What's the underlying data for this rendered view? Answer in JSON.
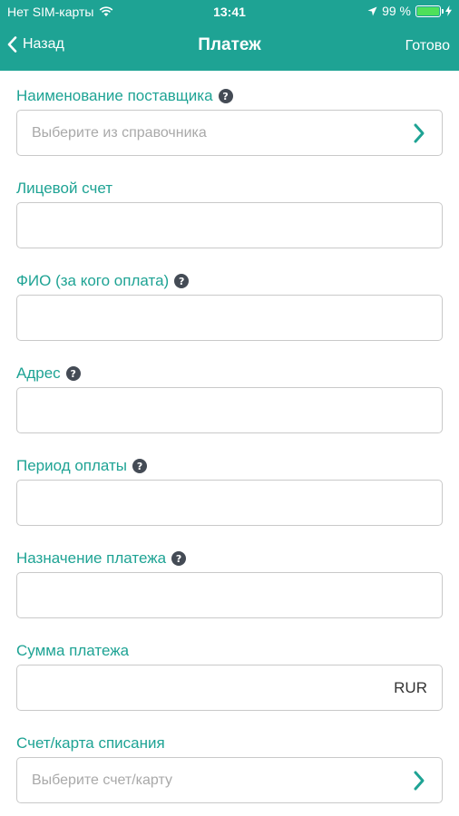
{
  "status": {
    "carrier": "Нет SIM-карты",
    "time": "13:41",
    "battery": "99 %",
    "battery_level": 0.99
  },
  "nav": {
    "back_label": "Назад",
    "title": "Платеж",
    "done_label": "Готово"
  },
  "fields": [
    {
      "label": "Наименование поставщика",
      "help": "?",
      "placeholder": "Выберите из справочника"
    },
    {
      "label": "Лицевой счет"
    },
    {
      "label": "ФИО (за кого оплата)",
      "help": "?"
    },
    {
      "label": "Адрес",
      "help": "?"
    },
    {
      "label": "Период оплаты",
      "help": "?"
    },
    {
      "label": "Назначение платежа",
      "help": "?"
    },
    {
      "label": "Сумма платежа",
      "suffix": "RUR"
    },
    {
      "label": "Счет/карта списания",
      "placeholder": "Выберите счет/карту"
    }
  ],
  "colors": {
    "accent": "#1ea394",
    "border": "#c9c9c9",
    "help_icon": "#444b55"
  }
}
